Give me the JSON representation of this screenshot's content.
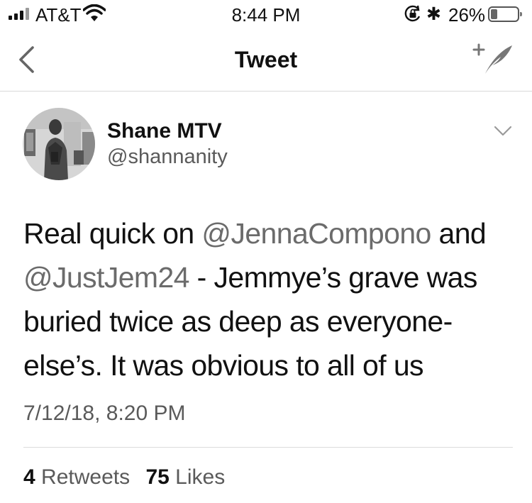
{
  "status_bar": {
    "carrier": "AT&T",
    "time": "8:44 PM",
    "battery_percent": "26%",
    "battery_level": 0.26,
    "icons": [
      "signal-icon",
      "wifi-icon",
      "orientation-lock-icon",
      "bluetooth-icon",
      "battery-icon"
    ]
  },
  "nav": {
    "title": "Tweet",
    "back_icon": "chevron-left-icon",
    "compose_icon": "compose-tweet-icon"
  },
  "tweet": {
    "display_name": "Shane MTV",
    "handle": "@shannanity",
    "menu_icon": "chevron-down-icon",
    "text_parts": [
      {
        "type": "text",
        "value": "Real quick on "
      },
      {
        "type": "mention",
        "value": "@JennaCompono"
      },
      {
        "type": "text",
        "value": " and "
      },
      {
        "type": "mention",
        "value": "@JustJem24"
      },
      {
        "type": "text",
        "value": " - Jemmye’s grave was buried twice as deep as everyone-else’s. It was obvious to all of us"
      }
    ],
    "timestamp": "7/12/18, 8:20 PM",
    "retweets_count": "4",
    "retweets_label": "Retweets",
    "likes_count": "75",
    "likes_label": "Likes"
  }
}
